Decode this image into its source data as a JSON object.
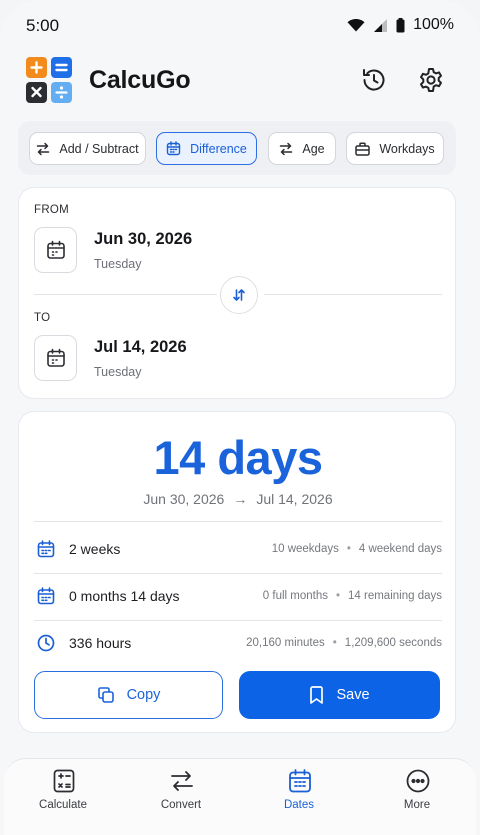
{
  "status_bar": {
    "time": "5:00",
    "battery": "100%"
  },
  "app": {
    "title": "CalcuGo",
    "logo_tiles": [
      "+",
      "=",
      "×",
      "÷"
    ],
    "colors": {
      "accent": "#1a63db",
      "primary_button": "#0d63e6",
      "logo_orange": "#f28a1c",
      "logo_blue": "#1f6fe8",
      "logo_dark": "#2b2d31",
      "logo_light_blue": "#63aef2"
    }
  },
  "toolbar": {
    "history_icon": "history-icon",
    "settings_icon": "gear-icon"
  },
  "modes": [
    {
      "label": "Add / Subtract",
      "icon": "swap-arrows-icon",
      "active": false
    },
    {
      "label": "Difference",
      "icon": "calendar-icon",
      "active": true
    },
    {
      "label": "Age",
      "icon": "swap-arrows-icon",
      "active": false
    },
    {
      "label": "Workdays",
      "icon": "briefcase-icon",
      "active": false
    }
  ],
  "dates": {
    "from": {
      "label": "FROM",
      "date": "Jun 30, 2026",
      "weekday": "Tuesday"
    },
    "to": {
      "label": "TO",
      "date": "Jul 14, 2026",
      "weekday": "Tuesday"
    }
  },
  "result": {
    "headline": "14 days",
    "range_start": "Jun 30, 2026",
    "range_arrow": "→",
    "range_end": "Jul 14, 2026",
    "rows": [
      {
        "main": "2 weeks",
        "detail_a": "10 weekdays",
        "detail_b": "4 weekend days",
        "icon": "calendar-icon"
      },
      {
        "main": "0 months 14 days",
        "detail_a": "0 full months",
        "detail_b": "14 remaining days",
        "icon": "calendar-icon"
      },
      {
        "main": "336 hours",
        "detail_a": "20,160 minutes",
        "detail_b": "1,209,600 seconds",
        "icon": "clock-icon"
      }
    ],
    "separator": "•",
    "copy_label": "Copy",
    "save_label": "Save"
  },
  "bottom_nav": [
    {
      "label": "Calculate",
      "icon": "calculator-icon",
      "active": false
    },
    {
      "label": "Convert",
      "icon": "swap-arrows-icon",
      "active": false
    },
    {
      "label": "Dates",
      "icon": "calendar-icon",
      "active": true
    },
    {
      "label": "More",
      "icon": "more-icon",
      "active": false
    }
  ]
}
